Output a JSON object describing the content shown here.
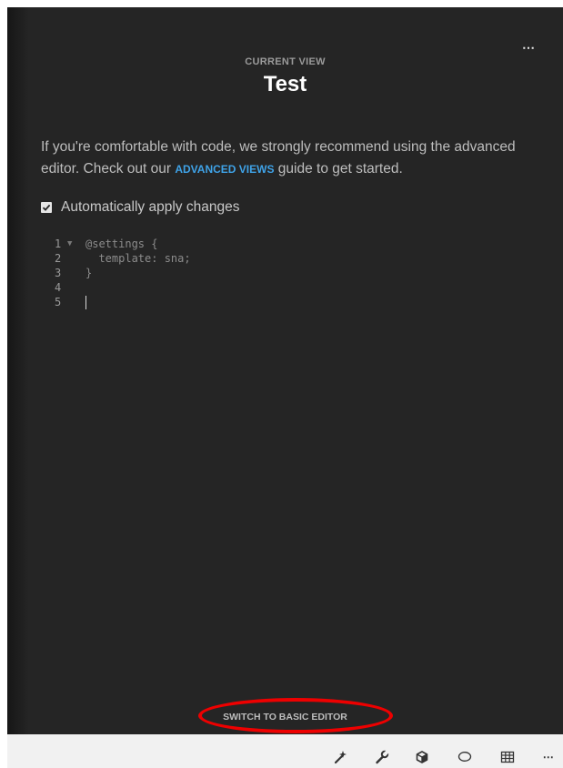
{
  "header": {
    "kicker": "CURRENT VIEW",
    "title": "Test",
    "more_icon": "⋯"
  },
  "description": {
    "before": "If you're comfortable with code, we strongly recommend using the advanced editor. Check out our ",
    "link": "ADVANCED VIEWS",
    "after": " guide to get started."
  },
  "auto_apply": {
    "label": "Automatically apply changes",
    "checked": true
  },
  "editor": {
    "lines": [
      {
        "number": "1",
        "text": "@settings {"
      },
      {
        "number": "2",
        "text": "  template: sna;"
      },
      {
        "number": "3",
        "text": "}"
      },
      {
        "number": "4",
        "text": ""
      },
      {
        "number": "5",
        "text": ""
      }
    ]
  },
  "footer": {
    "switch_label": "SWITCH TO BASIC EDITOR",
    "highlight_color": "#ee0000"
  },
  "toolbar": {
    "icons": [
      "magic-wand-icon",
      "wrench-icon",
      "cube-icon",
      "comment-icon",
      "table-icon",
      "more-icon"
    ],
    "more_label": "⋯"
  }
}
